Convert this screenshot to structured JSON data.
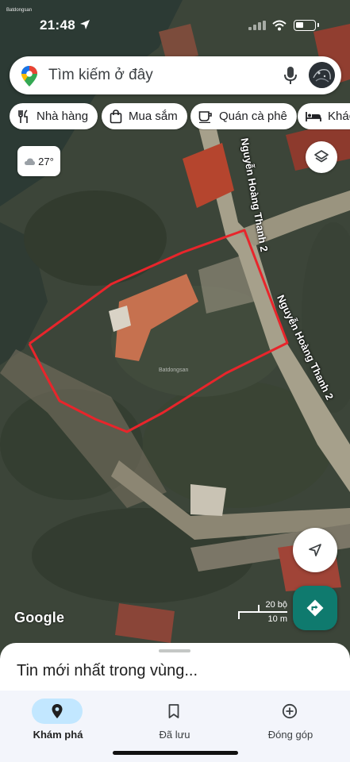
{
  "status_bar": {
    "time": "21:48",
    "watermark": "Batdongsan"
  },
  "search": {
    "placeholder": "Tìm kiếm ở đây"
  },
  "chips": [
    {
      "label": "Nhà hàng",
      "icon": "restaurant-icon"
    },
    {
      "label": "Mua sắm",
      "icon": "shopping-bag-icon"
    },
    {
      "label": "Quán cà phê",
      "icon": "coffee-cup-icon"
    },
    {
      "label": "Khác",
      "icon": "hotel-bed-icon"
    }
  ],
  "weather": {
    "temperature": "27°",
    "icon": "cloud-icon"
  },
  "map": {
    "street_top": "Nguyễn Hoàng Thanh 2",
    "street_main": "Nguyễn Hoàng Thanh 2",
    "watermark": "Batdongsan",
    "google": "Google",
    "scale_ft": "20 bộ",
    "scale_m": "10 m",
    "outline_color": "#e8252b"
  },
  "sheet": {
    "title": "Tin mới nhất trong vùng..."
  },
  "nav": [
    {
      "label": "Khám phá",
      "icon": "explore-pin-icon",
      "active": true
    },
    {
      "label": "Đã lưu",
      "icon": "bookmark-icon",
      "active": false
    },
    {
      "label": "Đóng góp",
      "icon": "add-circle-icon",
      "active": false
    }
  ],
  "colors": {
    "accent": "#0f7a6e",
    "nav_active": "#c2e7ff",
    "boundary": "#e8252b"
  }
}
